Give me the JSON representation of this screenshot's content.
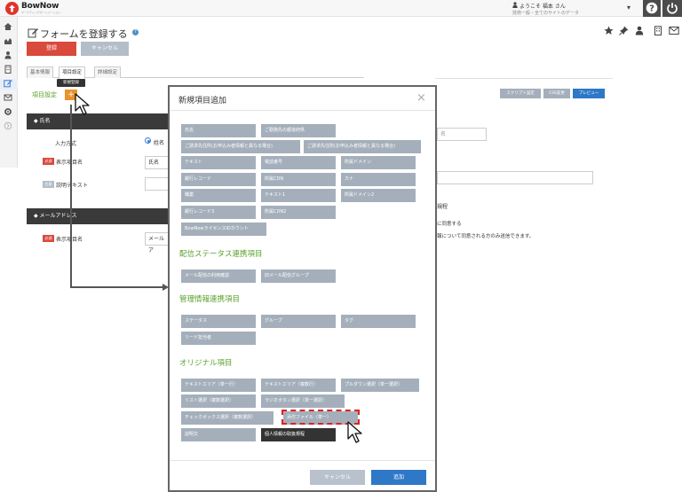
{
  "app": {
    "logo": "BowNow",
    "logo_sub": "マーケティングオートメーション"
  },
  "topbar": {
    "welcome": "ようこそ 福本 さん",
    "user_line": "技術一般・全てのサイトのデータ"
  },
  "page": {
    "title": "フォームを登録する",
    "register_label": "登録",
    "cancel_label": "キャンセル"
  },
  "tabs": [
    "基本情報",
    "項目設定",
    "詳細設定"
  ],
  "section": {
    "label": "項目設定",
    "add_label": "+",
    "tooltip": "新規登録"
  },
  "fields": {
    "name_header": "氏名",
    "input_format_label": "入力方式",
    "radio_label": "姓名",
    "required_badge": "必須",
    "optional_badge": "任意",
    "display_name_label": "表示項目名",
    "display_name_value": "氏名",
    "desc_label": "説明テキスト",
    "mail_header": "メールアドレス",
    "mail_display_name_value": "メールア"
  },
  "preview": {
    "buttons": [
      "スクリプト設定",
      "CSS変更",
      "プレビュー"
    ],
    "name_placeholder": "名",
    "privacy_title": "規程",
    "privacy_agree": "に同意する",
    "privacy_note": "報について同意される方のみ送信できます。"
  },
  "modal": {
    "title": "新規項目追加",
    "close": "×",
    "basic_items": [
      "氏名",
      "ご勤務先の都道府県",
      "ご請求先住所(お申込み者情報と異なる場合)",
      "ご請求先住所(お申込み者情報と異なる場合)",
      "テキスト",
      "電話番号",
      "所属ドメイン",
      "銀行レコード",
      "所属CDN",
      "カナ",
      "職業",
      "テキスト1",
      "所属ドメイン2",
      "銀行レコード3",
      "所属CDN2",
      "BowNowライセンスIDカウント"
    ],
    "delivery_title": "配信ステータス連携項目",
    "delivery_items": [
      "メール配信の利用確認",
      "旧メール配信グループ"
    ],
    "mgmt_title": "管理情報連携項目",
    "mgmt_items": [
      "ステータス",
      "グループ",
      "タグ",
      "リード担当者"
    ],
    "original_title": "オリジナル項目",
    "original_items": [
      "テキストエリア（単一行）",
      "テキストエリア（複数行）",
      "プルダウン選択（単一選択）",
      "リスト選択（複数選択）",
      "ラジオボタン選択（単一選択）",
      "チェックボックス選択（複数選択）",
      "添付ファイル（単一）",
      "説明文",
      "個人情報の取扱規程"
    ],
    "cancel_label": "キャンセル",
    "add_label": "追加"
  },
  "colors": {
    "accent_red": "#d9493c",
    "accent_green": "#5aa02c",
    "accent_blue": "#2e78c7",
    "item_gray": "#a4afbb"
  }
}
